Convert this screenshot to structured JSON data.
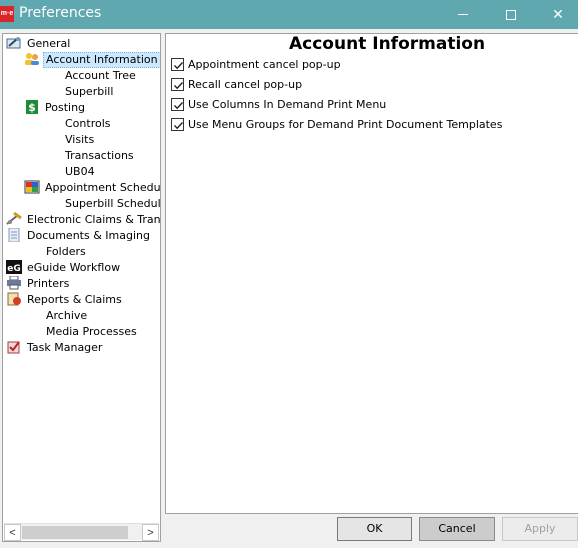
{
  "window": {
    "title": "Preferences",
    "app_icon_text": "m·e",
    "close_glyph": "✕"
  },
  "tree": {
    "items": [
      {
        "label": "General",
        "icon": "wrench-icon"
      },
      {
        "label": "Account Information",
        "icon": "user-group-icon"
      },
      {
        "label": "Account Tree",
        "icon": ""
      },
      {
        "label": "Superbill",
        "icon": ""
      },
      {
        "label": "Posting",
        "icon": "dollar-icon"
      },
      {
        "label": "Controls",
        "icon": ""
      },
      {
        "label": "Visits",
        "icon": ""
      },
      {
        "label": "Transactions",
        "icon": ""
      },
      {
        "label": "UB04",
        "icon": ""
      },
      {
        "label": "Appointment Scheduler",
        "icon": "calendar-grid-icon"
      },
      {
        "label": "Superbill Scheduler",
        "icon": ""
      },
      {
        "label": "Electronic Claims & Transmis",
        "icon": "satellite-icon"
      },
      {
        "label": "Documents & Imaging",
        "icon": "document-icon"
      },
      {
        "label": "Folders",
        "icon": ""
      },
      {
        "label": "eGuide Workflow",
        "icon": "eg-icon"
      },
      {
        "label": "Printers",
        "icon": "printer-icon"
      },
      {
        "label": "Reports & Claims",
        "icon": "reports-icon"
      },
      {
        "label": "Archive",
        "icon": ""
      },
      {
        "label": "Media Processes",
        "icon": ""
      },
      {
        "label": "Task Manager",
        "icon": "task-manager-icon"
      }
    ],
    "selected": "Account Information",
    "scroll_left": "<",
    "scroll_right": ">"
  },
  "content": {
    "title": "Account Information",
    "options": [
      {
        "label": "Appointment cancel pop-up",
        "checked": true
      },
      {
        "label": "Recall cancel pop-up",
        "checked": true
      },
      {
        "label": "Use Columns In Demand Print Menu",
        "checked": true
      },
      {
        "label": "Use Menu Groups for Demand Print Document Templates",
        "checked": true
      }
    ]
  },
  "buttons": {
    "ok": "OK",
    "cancel": "Cancel",
    "apply": "Apply"
  },
  "colors": {
    "titlebar": "#5fa8b0",
    "selection": "#cce8ff"
  }
}
